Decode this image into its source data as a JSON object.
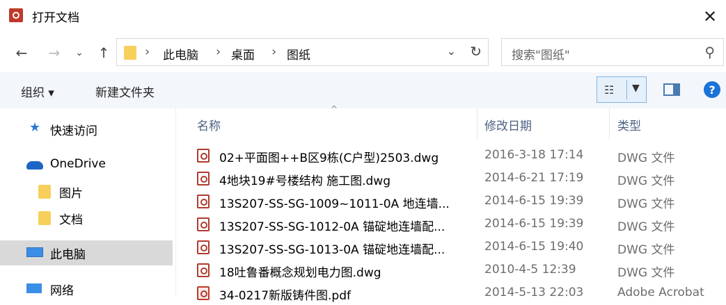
{
  "window": {
    "title": "打开文档"
  },
  "nav": {
    "back": "←",
    "forward": "→",
    "recent": "⌄",
    "up": "↑"
  },
  "address": {
    "crumbs": [
      "此电脑",
      "桌面",
      "图纸"
    ],
    "separator": "›"
  },
  "search": {
    "placeholder": "搜索\"图纸\""
  },
  "toolbar": {
    "organize": "组织 ▾",
    "new_folder": "新建文件夹",
    "help": "?"
  },
  "sidebar": {
    "items": [
      {
        "label": "快速访问",
        "icon": "star-icon"
      },
      {
        "label": "OneDrive",
        "icon": "cloud-icon"
      },
      {
        "label": "图片",
        "icon": "folder-icon"
      },
      {
        "label": "文档",
        "icon": "folder-icon"
      },
      {
        "label": "此电脑",
        "icon": "computer-icon",
        "selected": true
      },
      {
        "label": "网络",
        "icon": "network-icon"
      }
    ]
  },
  "columns": {
    "name": "名称",
    "date": "修改日期",
    "type": "类型"
  },
  "files": [
    {
      "name": "02+平面图++B区9栋(C户型)2503.dwg",
      "date": "2016-3-18 17:14",
      "type": "DWG 文件"
    },
    {
      "name": "4地块19#号楼结构 施工图.dwg",
      "date": "2014-6-21 17:19",
      "type": "DWG 文件"
    },
    {
      "name": "13S207-SS-SG-1009~1011-0A 地连墙...",
      "date": "2014-6-15 19:39",
      "type": "DWG 文件"
    },
    {
      "name": "13S207-SS-SG-1012-0A 锚碇地连墙配...",
      "date": "2014-6-15 19:39",
      "type": "DWG 文件"
    },
    {
      "name": "13S207-SS-SG-1013-0A 锚碇地连墙配...",
      "date": "2014-6-15 19:40",
      "type": "DWG 文件"
    },
    {
      "name": "18吐鲁番概念规划电力图.dwg",
      "date": "2010-4-5 12:39",
      "type": "DWG 文件"
    },
    {
      "name": "34-0217新版铸件图.pdf",
      "date": "2014-5-13 22:03",
      "type": "Adobe Acrobat"
    }
  ],
  "colors": {
    "accent": "#1a73d9",
    "selected_bg": "#d9d9d9",
    "toolbar_bg": "#f3f6fb"
  }
}
